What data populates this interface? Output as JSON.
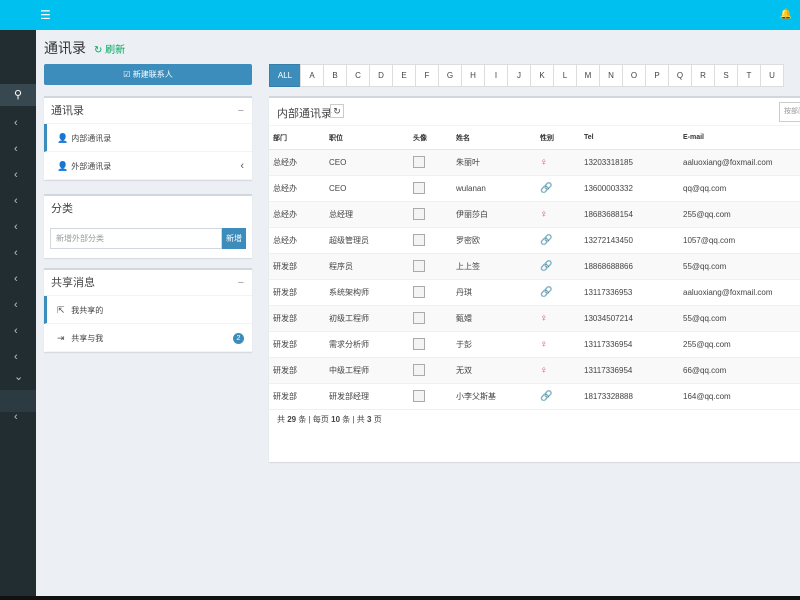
{
  "topbar": {
    "menu_icon": "☰",
    "bell_icon": "🔔"
  },
  "sidebar_icons": {
    "search": "⚲",
    "chev_left": "‹",
    "chev_down": "⌄"
  },
  "page": {
    "title": "通讯录",
    "refresh": "↻ 刷新"
  },
  "new_contact_btn": "☑ 新建联系人",
  "contacts_box": {
    "title": "通讯录",
    "collapse": "−",
    "items": [
      {
        "icon": "👤",
        "label": "内部通讯录"
      },
      {
        "icon": "👤",
        "label": "外部通讯录",
        "chev": "‹"
      }
    ]
  },
  "category_box": {
    "title": "分类",
    "placeholder": "新增外部分类",
    "btn": "新增"
  },
  "share_box": {
    "title": "共享消息",
    "collapse": "−",
    "items": [
      {
        "icon": "⇱",
        "label": "我共享的"
      },
      {
        "icon": "⇥",
        "label": "共享与我",
        "badge": "2"
      }
    ]
  },
  "alphabet": [
    "ALL",
    "A",
    "B",
    "C",
    "D",
    "E",
    "F",
    "G",
    "H",
    "I",
    "J",
    "K",
    "L",
    "M",
    "N",
    "O",
    "P",
    "Q",
    "R",
    "S",
    "T",
    "U"
  ],
  "panel": {
    "title": "内部通讯录",
    "refresh": "↻",
    "search_placeholder": "按部门"
  },
  "table": {
    "headers": [
      "部门",
      "职位",
      "头像",
      "姓名",
      "性别",
      "Tel",
      "E-mail"
    ],
    "rows": [
      {
        "dept": "总经办",
        "pos": "CEO",
        "name": "朱丽叶",
        "sex": "f",
        "tel": "13203318185",
        "email": "aaluoxiang@foxmail.com"
      },
      {
        "dept": "总经办",
        "pos": "CEO",
        "name": "wulanan",
        "sex": "m",
        "tel": "13600003332",
        "email": "qq@qq.com"
      },
      {
        "dept": "总经办",
        "pos": "总经理",
        "name": "伊丽莎白",
        "sex": "f",
        "tel": "18683688154",
        "email": "255@qq.com"
      },
      {
        "dept": "总经办",
        "pos": "超级管理员",
        "name": "罗密欧",
        "sex": "m",
        "tel": "13272143450",
        "email": "1057@qq.com"
      },
      {
        "dept": "研发部",
        "pos": "程序员",
        "name": "上上签",
        "sex": "m",
        "tel": "18868688866",
        "email": "55@qq.com"
      },
      {
        "dept": "研发部",
        "pos": "系统架构师",
        "name": "丹琪",
        "sex": "m",
        "tel": "13117336953",
        "email": "aaluoxiang@foxmail.com"
      },
      {
        "dept": "研发部",
        "pos": "初级工程师",
        "name": "甄嬛",
        "sex": "f",
        "tel": "13034507214",
        "email": "55@qq.com"
      },
      {
        "dept": "研发部",
        "pos": "需求分析师",
        "name": "于彭",
        "sex": "f",
        "tel": "13117336954",
        "email": "255@qq.com"
      },
      {
        "dept": "研发部",
        "pos": "中级工程师",
        "name": "无双",
        "sex": "f",
        "tel": "13117336954",
        "email": "66@qq.com"
      },
      {
        "dept": "研发部",
        "pos": "研发部经理",
        "name": "小李父斯基",
        "sex": "m",
        "tel": "18173328888",
        "email": "164@qq.com"
      }
    ]
  },
  "pager": {
    "prefix": "共",
    "total": "29",
    "unit1": "条 | 每页",
    "per_page": "10",
    "unit2": "条 | 共",
    "pages": "3",
    "unit3": "页"
  },
  "sex_icons": {
    "f": "♀",
    "m": "🔗"
  },
  "colors": {
    "topbar": "#00c0ef",
    "sidebar": "#222d32",
    "primary": "#3c8dbc",
    "female": "#dd4b39",
    "male": "#3c8dbc",
    "refresh": "#00a65a"
  }
}
